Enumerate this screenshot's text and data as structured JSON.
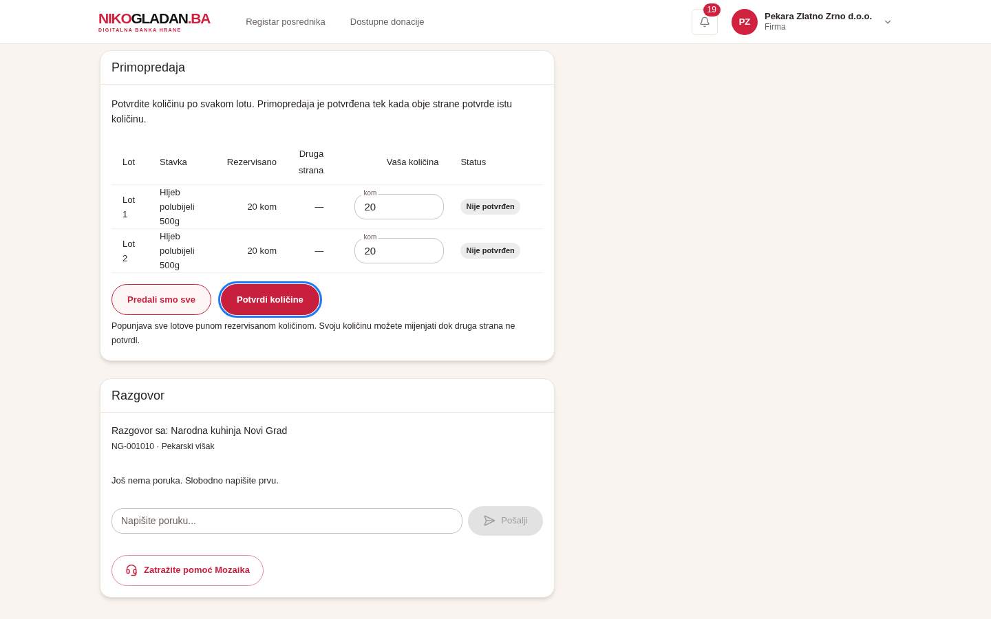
{
  "header": {
    "logo": {
      "parts": [
        {
          "text": "NIKO",
          "color": "#d0213f"
        },
        {
          "text": "GLADAN",
          "color": "#111111"
        },
        {
          "text": ".BA",
          "color": "#d0213f"
        }
      ],
      "tagline": "DIGITALNA BANKA HRANE"
    },
    "nav": [
      "Registar posrednika",
      "Dostupne donacije"
    ],
    "notifications": {
      "count": "19"
    },
    "user": {
      "initials": "PZ",
      "name": "Pekara Zlatno Zrno d.o.o.",
      "role": "Firma"
    }
  },
  "handover": {
    "title": "Primopredaja",
    "intro": "Potvrdite količinu po svakom lotu. Primopredaja je potvrđena tek kada obje strane potvrde istu količinu.",
    "columns": [
      "Lot",
      "Stavka",
      "Rezervisano",
      "Druga strana",
      "Vaša količina",
      "Status"
    ],
    "rows": [
      {
        "lot": "Lot 1",
        "item": "Hljeb polubijeli 500g",
        "reserved": "20 kom",
        "other": "—",
        "unit": "kom",
        "value": "20",
        "status": "Nije potvrđen"
      },
      {
        "lot": "Lot 2",
        "item": "Hljeb polubijeli 500g",
        "reserved": "20 kom",
        "other": "—",
        "unit": "kom",
        "value": "20",
        "status": "Nije potvrđen"
      }
    ],
    "buttons": [
      {
        "label": "Predali smo sve",
        "kind": "outline",
        "focused": false
      },
      {
        "label": "Potvrdi količine",
        "kind": "primary",
        "focused": true
      }
    ],
    "note": "Popunjava sve lotove punom rezervisanom količinom. Svoju količinu možete mijenjati dok druga strana ne potvrdi."
  },
  "chat": {
    "title": "Razgovor",
    "partner": "Razgovor sa: Narodna kuhinja Novi Grad",
    "meta": "NG-001010 · Pekarski višak",
    "empty": "Još nema poruka. Slobodno napišite prvu.",
    "input": {
      "placeholder": "Napišite poruku..."
    },
    "send": {
      "label": "Pošalji",
      "disabled": true
    },
    "help": {
      "label": "Zatražite pomoć Mozaika"
    }
  }
}
